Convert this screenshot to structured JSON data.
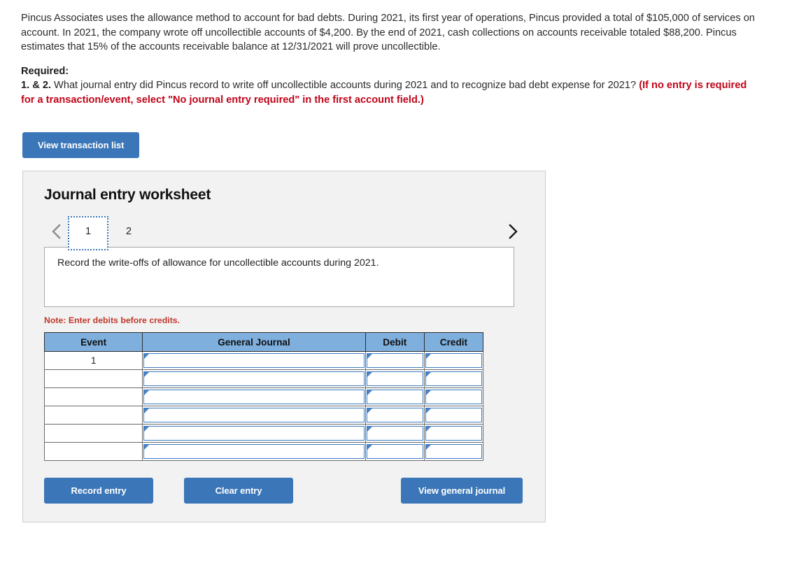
{
  "problem": {
    "paragraph": "Pincus Associates uses the allowance method to account for bad debts.  During 2021, its first year of operations, Pincus provided a total of $105,000 of services on account. In 2021, the company wrote off uncollectible accounts of $4,200.  By the end of 2021, cash collections on accounts receivable totaled $88,200.  Pincus estimates that 15% of the accounts receivable balance at 12/31/2021 will prove uncollectible."
  },
  "required": {
    "label": "Required:",
    "question_number": "1. & 2.",
    "question_text": " What journal entry did Pincus record to write off uncollectible accounts during 2021 and to recognize bad debt expense for 2021? ",
    "red_note": "(If no entry is required for a transaction/event, select \"No journal entry required\" in the first account field.)"
  },
  "toolbar": {
    "view_transaction_list": "View transaction list"
  },
  "worksheet": {
    "title": "Journal entry worksheet",
    "prev_arrow": "chevron-left",
    "next_arrow": "chevron-right",
    "tabs": [
      {
        "label": "1",
        "active": true
      },
      {
        "label": "2",
        "active": false
      }
    ],
    "instruction": "Record the write-offs of allowance for uncollectible accounts during 2021.",
    "note": "Note: Enter debits before credits.",
    "table": {
      "headers": [
        "Event",
        "General Journal",
        "Debit",
        "Credit"
      ],
      "rows": [
        {
          "event": "1",
          "general_journal": "",
          "debit": "",
          "credit": ""
        },
        {
          "event": "",
          "general_journal": "",
          "debit": "",
          "credit": ""
        },
        {
          "event": "",
          "general_journal": "",
          "debit": "",
          "credit": ""
        },
        {
          "event": "",
          "general_journal": "",
          "debit": "",
          "credit": ""
        },
        {
          "event": "",
          "general_journal": "",
          "debit": "",
          "credit": ""
        },
        {
          "event": "",
          "general_journal": "",
          "debit": "",
          "credit": ""
        }
      ]
    },
    "buttons": {
      "record_entry": "Record entry",
      "clear_entry": "Clear entry",
      "view_general_journal": "View general journal"
    }
  },
  "colors": {
    "button_blue": "#3a76b8",
    "table_header_blue": "#7eafdd",
    "panel_gray": "#f2f2f2",
    "red": "#c00418",
    "note_red": "#c0392b",
    "cell_border_blue": "#3d7cc0"
  }
}
